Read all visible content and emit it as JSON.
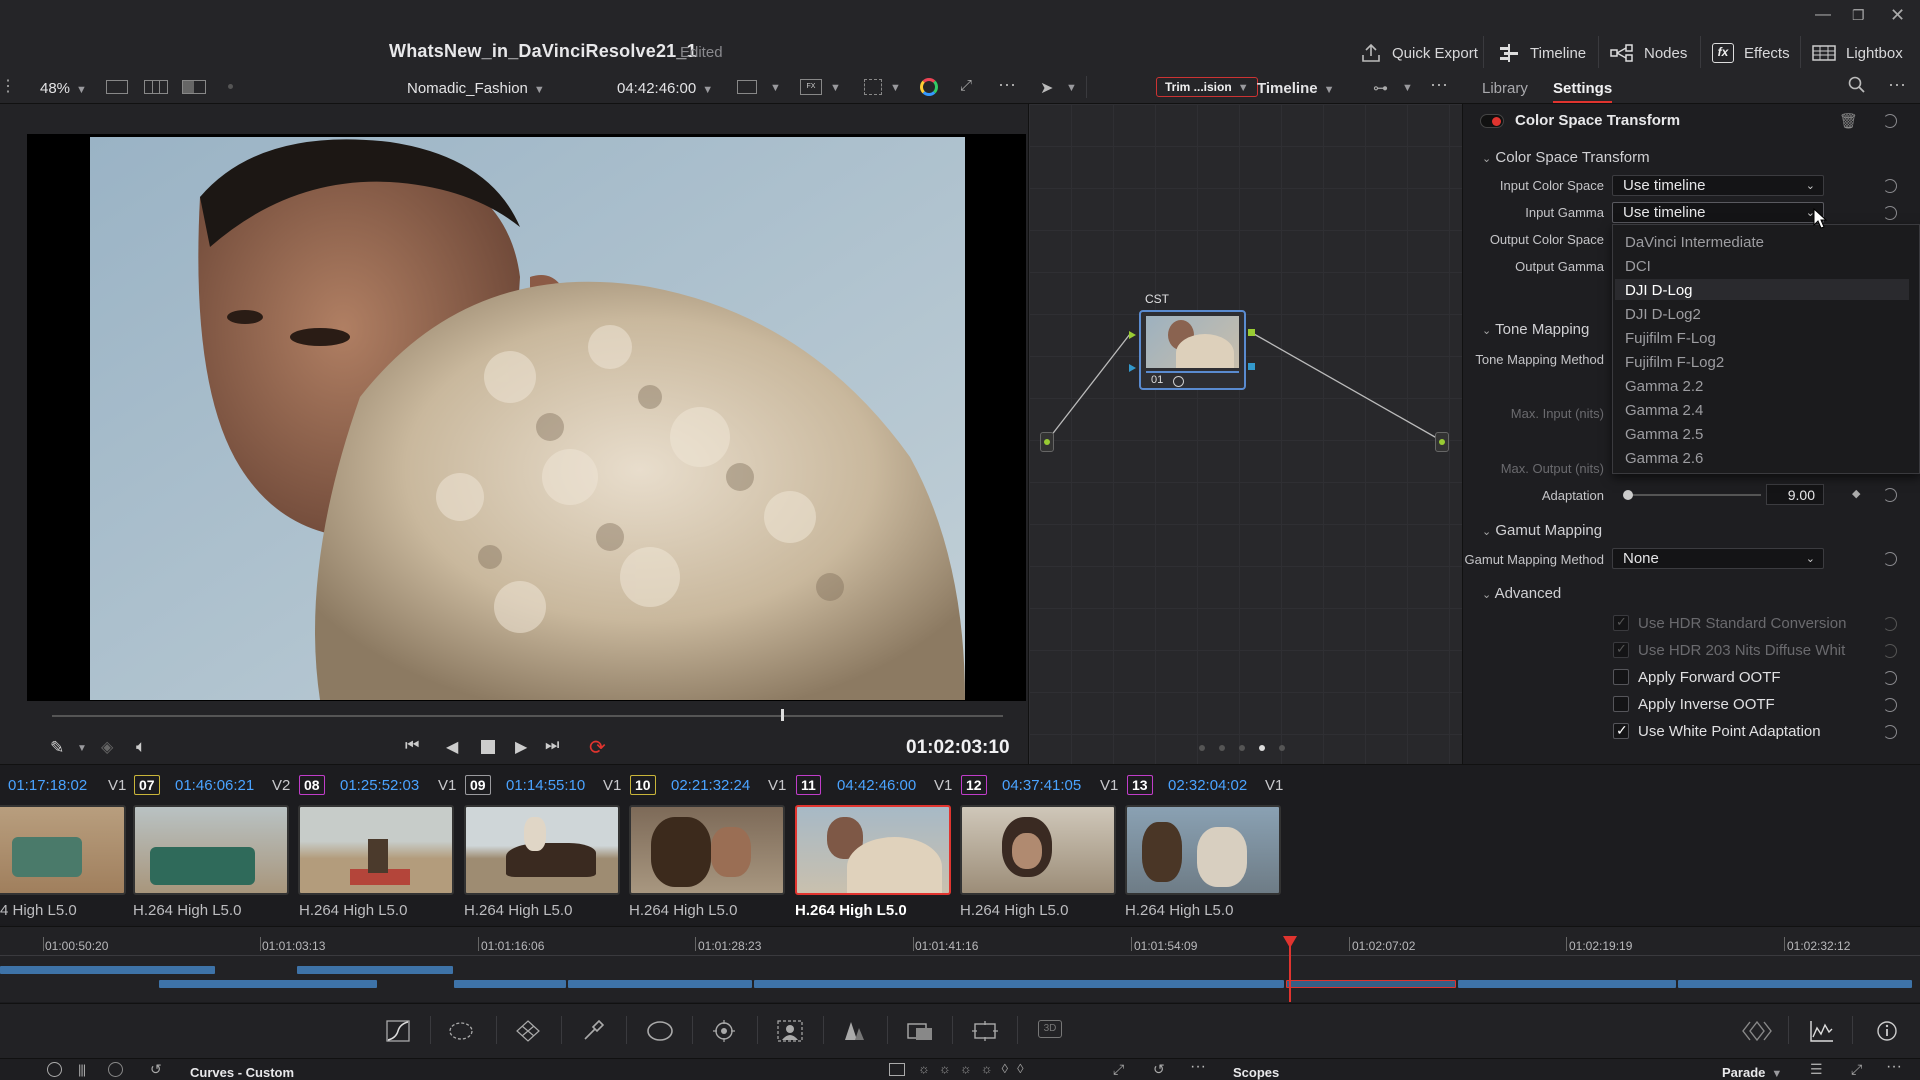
{
  "window": {
    "title": "WhatsNew_in_DaVinciResolve21_1",
    "status": "Edited"
  },
  "header": {
    "quick_export": "Quick Export",
    "timeline": "Timeline",
    "nodes": "Nodes",
    "effects": "Effects",
    "lightbox": "Lightbox"
  },
  "viewer": {
    "zoom": "48%",
    "clip_name": "Nomadic_Fashion",
    "timecode": "04:42:46:00",
    "playhead_tc": "01:02:03:10"
  },
  "node_toolbar": {
    "trim_label": "Trim ...ision",
    "mode": "Timeline"
  },
  "node_graph": {
    "node_label": "CST",
    "node_number": "01"
  },
  "settings_panel": {
    "tabs": [
      "Library",
      "Settings"
    ],
    "effect_title": "Color Space Transform",
    "section_cst": "Color Space Transform",
    "input_color_space_label": "Input Color Space",
    "input_color_space_value": "Use timeline",
    "input_gamma_label": "Input Gamma",
    "input_gamma_value": "Use timeline",
    "output_color_space_label": "Output Color Space",
    "output_gamma_label": "Output Gamma",
    "gamma_options": [
      "DaVinci Intermediate",
      "DCI",
      "DJI D-Log",
      "DJI D-Log2",
      "Fujifilm F-Log",
      "Fujifilm F-Log2",
      "Gamma 2.2",
      "Gamma 2.4",
      "Gamma 2.5",
      "Gamma 2.6"
    ],
    "highlighted_option": "DJI D-Log",
    "section_tone": "Tone Mapping",
    "tone_method_label": "Tone Mapping Method",
    "max_input_label": "Max. Input (nits)",
    "max_output_label": "Max. Output (nits)",
    "adaptation_label": "Adaptation",
    "adaptation_value": "9.00",
    "section_gamut": "Gamut Mapping",
    "gamut_method_label": "Gamut Mapping Method",
    "gamut_method_value": "None",
    "section_advanced": "Advanced",
    "checks": [
      {
        "label": "Use HDR Standard Conversion",
        "checked": true,
        "enabled": false
      },
      {
        "label": "Use HDR 203 Nits Diffuse Whit",
        "checked": true,
        "enabled": false
      },
      {
        "label": "Apply Forward OOTF",
        "checked": false,
        "enabled": true
      },
      {
        "label": "Apply Inverse OOTF",
        "checked": false,
        "enabled": true
      },
      {
        "label": "Use White Point Adaptation",
        "checked": true,
        "enabled": true
      }
    ]
  },
  "clips": [
    {
      "num": "",
      "tc": "01:17:18:02",
      "track": "V1",
      "codec": "4 High L5.0",
      "num_color": "#9a9a9e"
    },
    {
      "num": "07",
      "tc": "01:46:06:21",
      "track": "V2",
      "codec": "H.264 High L5.0",
      "num_color": "#c9b53a"
    },
    {
      "num": "08",
      "tc": "01:25:52:03",
      "track": "V1",
      "codec": "H.264 High L5.0",
      "num_color": "#c03dc9"
    },
    {
      "num": "09",
      "tc": "01:14:55:10",
      "track": "V1",
      "codec": "H.264 High L5.0",
      "num_color": "#9a9a9e"
    },
    {
      "num": "10",
      "tc": "02:21:32:24",
      "track": "V1",
      "codec": "H.264 High L5.0",
      "num_color": "#c9b53a"
    },
    {
      "num": "11",
      "tc": "04:42:46:00",
      "track": "V1",
      "codec": "H.264 High L5.0",
      "num_color": "#c03dc9"
    },
    {
      "num": "12",
      "tc": "04:37:41:05",
      "track": "V1",
      "codec": "H.264 High L5.0",
      "num_color": "#c03dc9"
    },
    {
      "num": "13",
      "tc": "02:32:04:02",
      "track": "V1",
      "codec": "H.264 High L5.0",
      "num_color": "#c03dc9"
    }
  ],
  "ruler": [
    "01:00:50:20",
    "01:01:03:13",
    "01:01:16:06",
    "01:01:28:23",
    "01:01:41:16",
    "01:01:54:09",
    "01:02:07:02",
    "01:02:19:19",
    "01:02:32:12"
  ],
  "bottom": {
    "curves_label": "Curves - Custom",
    "scopes_label": "Scopes",
    "scope_mode": "Parade"
  },
  "colors": {
    "accent_blue": "#3e73a8",
    "playhead_red": "#e0342f",
    "tc_blue": "#4aa3ff",
    "selection_red": "#e0342f"
  }
}
